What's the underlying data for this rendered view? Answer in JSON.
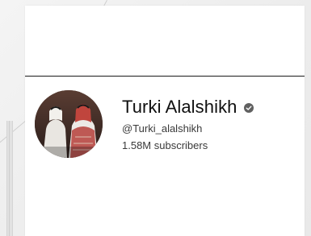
{
  "channel": {
    "name": "Turki Alalshikh",
    "handle": "@Turki_alalshikh",
    "subscribers": "1.58M subscribers",
    "verified": true,
    "avatar_description": "profile photo"
  },
  "colors": {
    "text_primary": "#0f0f0f",
    "text_secondary": "#3a3a3a",
    "verified_badge": "#606060",
    "card_background": "#ffffff",
    "page_background": "#f0f0f0"
  },
  "icons": {
    "verified": "check-circle-icon"
  }
}
